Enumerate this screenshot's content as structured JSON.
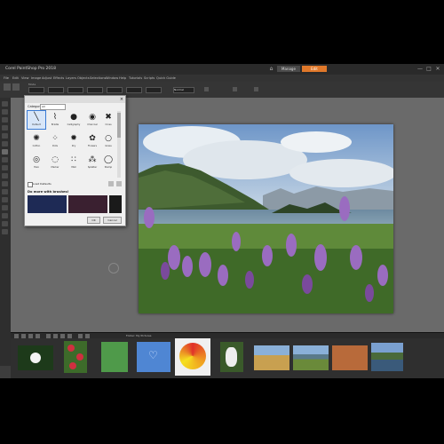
{
  "app": {
    "title": "Corel PaintShop Pro 2018",
    "workspace_tabs": [
      "Manage",
      "Edit"
    ],
    "active_tab": "Edit",
    "window_controls": [
      "—",
      "□",
      "✕"
    ],
    "home_icon": "home-icon"
  },
  "menu": [
    "File",
    "Edit",
    "View",
    "Image",
    "Adjust",
    "Effects",
    "Layers",
    "Objects",
    "Selections",
    "Window",
    "Help",
    "Tutorials",
    "Scripts",
    "Quick Guide"
  ],
  "tool_options": {
    "fields": [
      "Mode",
      "Normal",
      "Presets"
    ]
  },
  "dialog": {
    "title": "",
    "category_label": "Category:",
    "category_value": "All",
    "presets": [
      {
        "label": "Default",
        "symbol": "╲"
      },
      {
        "label": "Bristle",
        "symbol": "⌇"
      },
      {
        "label": "Calligraphy",
        "symbol": "●"
      },
      {
        "label": "Charcoal",
        "symbol": "◉"
      },
      {
        "label": "Cross",
        "symbol": "✖"
      },
      {
        "label": "Cotton",
        "symbol": "✺"
      },
      {
        "label": "Dots",
        "symbol": "⁘"
      },
      {
        "label": "Dry",
        "symbol": "✹"
      },
      {
        "label": "Flowers",
        "symbol": "✿"
      },
      {
        "label": "Grass",
        "symbol": "○"
      },
      {
        "label": "Halo",
        "symbol": "◎"
      },
      {
        "label": "Marker",
        "symbol": "◌"
      },
      {
        "label": "Mist",
        "symbol": "∷"
      },
      {
        "label": "Splatter",
        "symbol": "⁂"
      },
      {
        "label": "Stamp",
        "symbol": "◯"
      }
    ],
    "checkbox_label": "Load Defaults",
    "more_heading": "Do more with brushes!",
    "buttons": [
      "OK",
      "Cancel"
    ]
  },
  "filmstrip": {
    "label": "Folder: My Pictures",
    "thumbnails": [
      "white-flower",
      "red-flowers-on-green",
      "green-succulents",
      "blue-heart-on-glass",
      "rainbow-spiral",
      "white-cockatoo",
      "dry-grass-field",
      "lake-with-flowers",
      "orange-rock",
      "river-landscape"
    ]
  },
  "colors": {
    "accent": "#e0782a",
    "selection": "#3a7bd5"
  }
}
